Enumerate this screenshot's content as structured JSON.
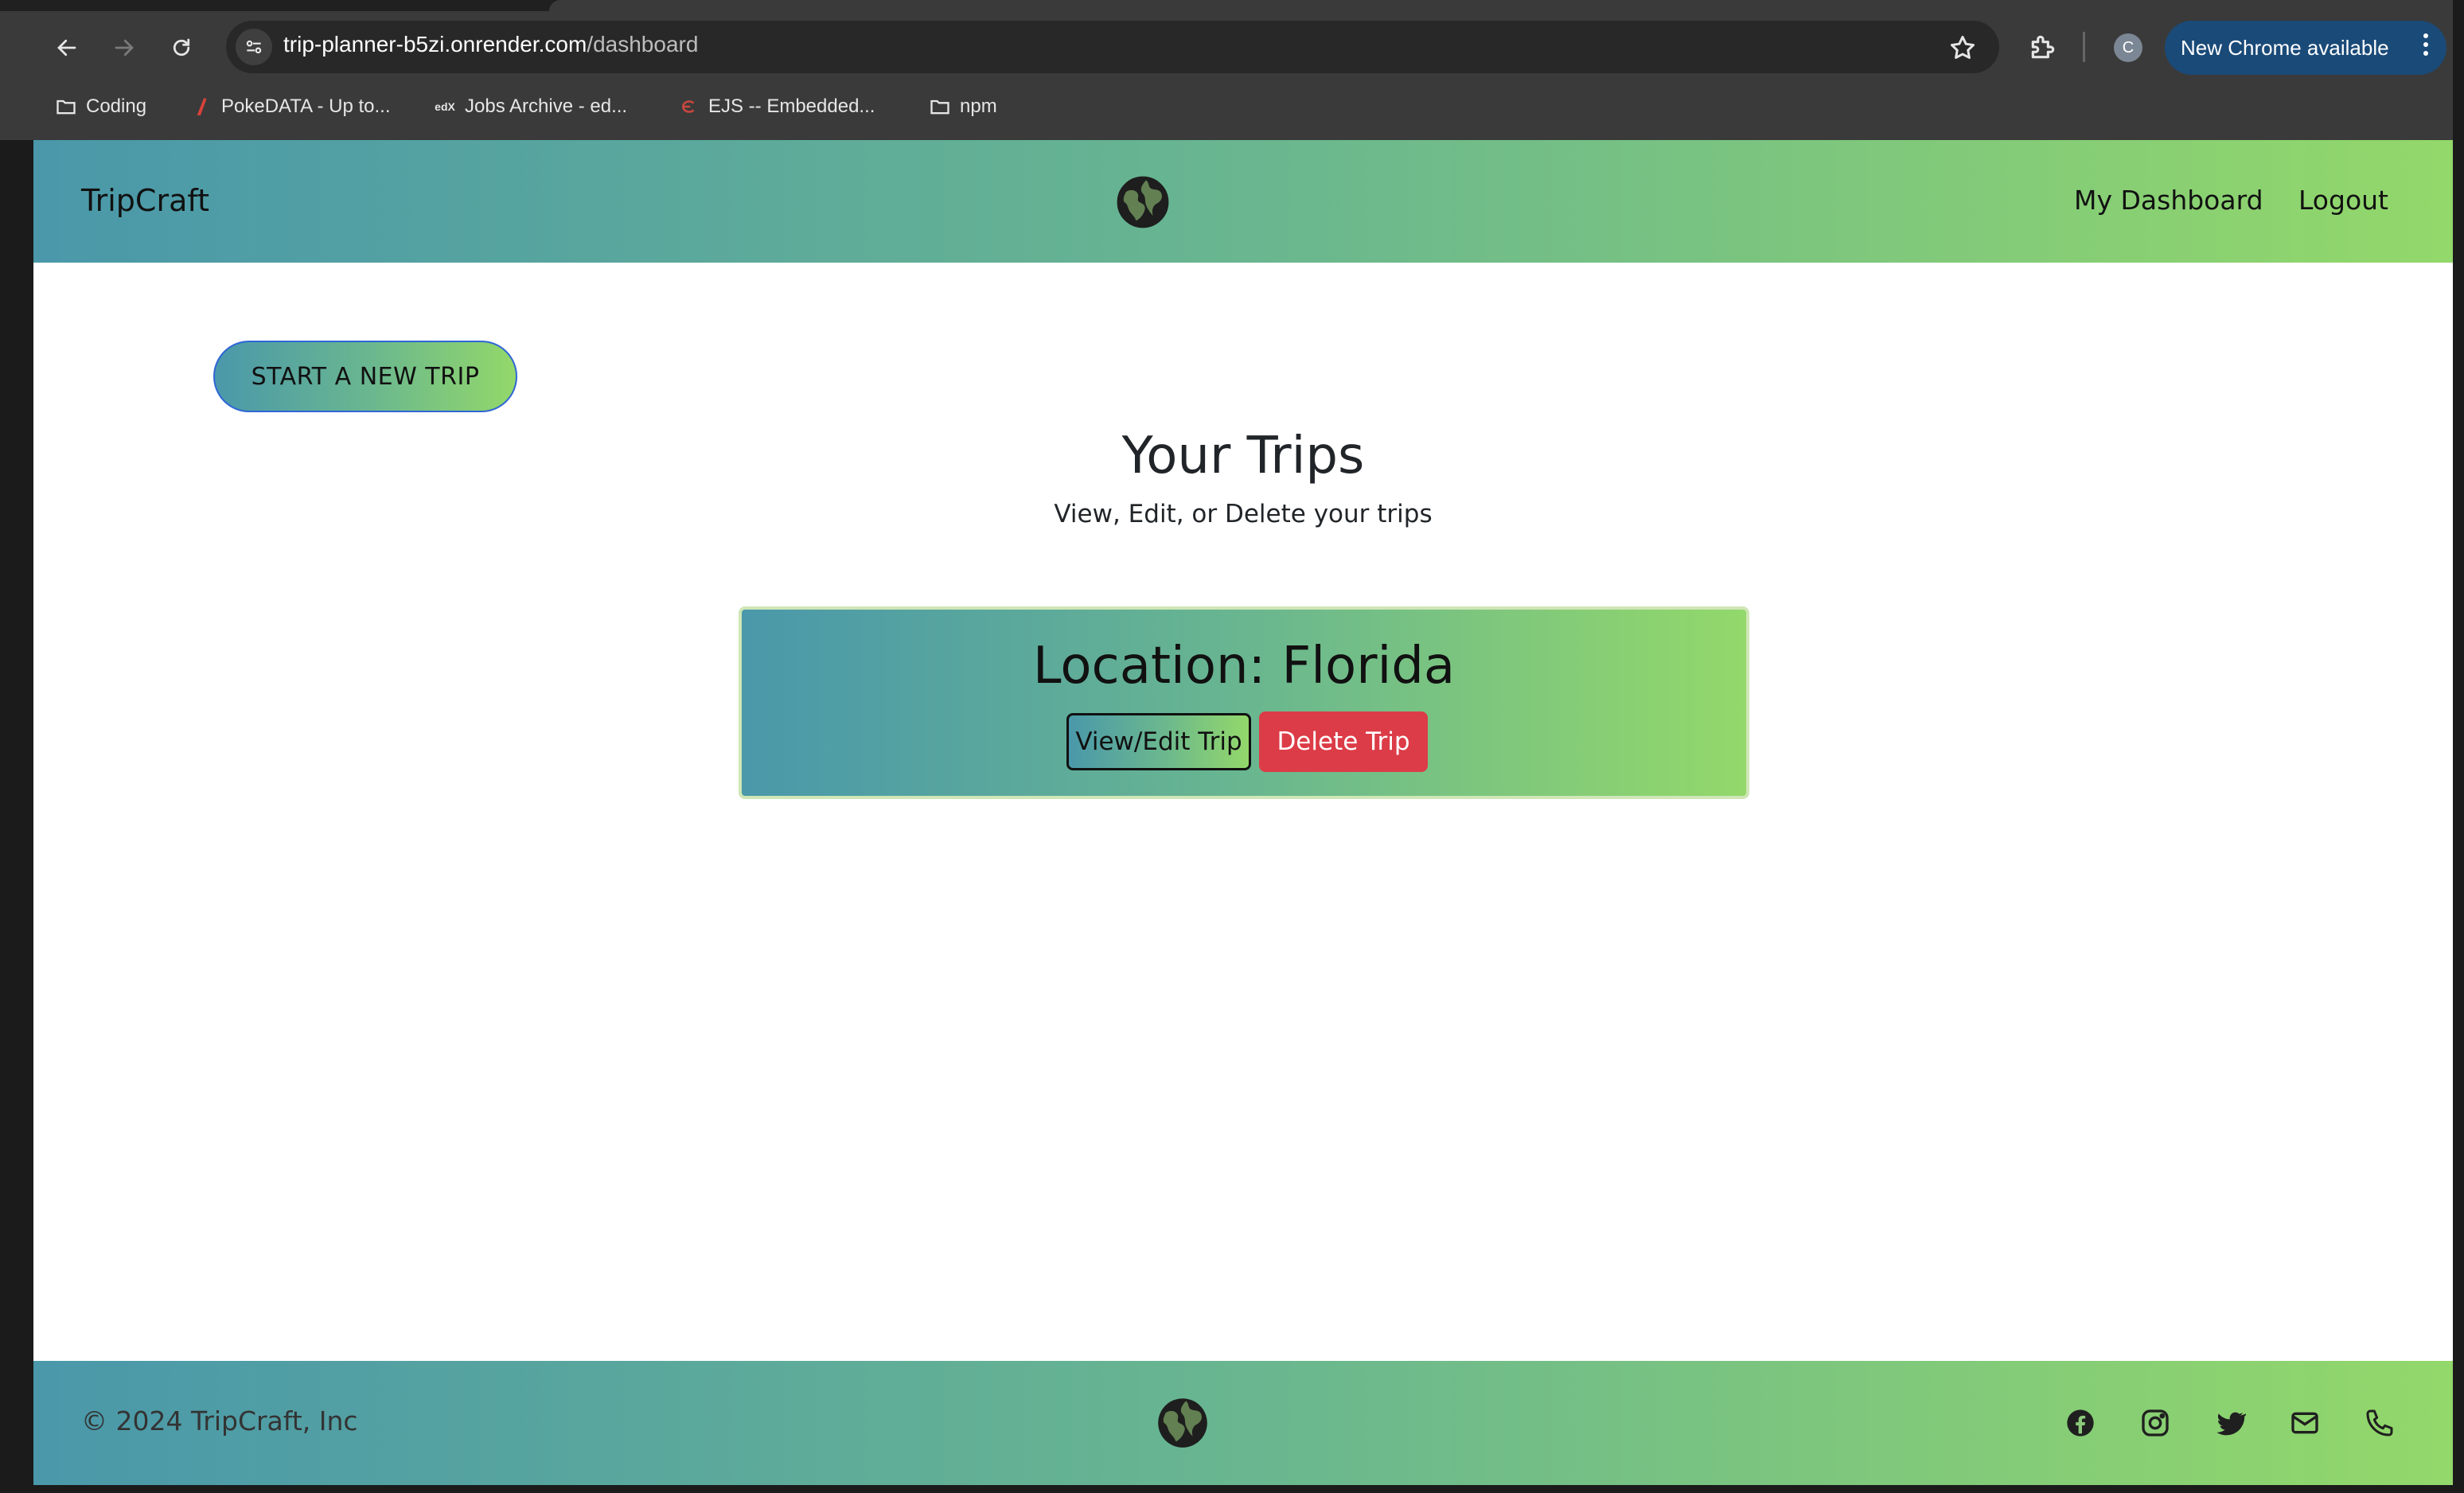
{
  "browser": {
    "url_host": "trip-planner-b5zi.onrender.com",
    "url_path": "/dashboard",
    "profile_initial": "C",
    "update_label": "New Chrome available",
    "bookmarks": [
      {
        "label": "Coding",
        "icon": "folder-icon"
      },
      {
        "label": "PokeDATA - Up to...",
        "icon": "pokedata-icon"
      },
      {
        "label": "Jobs Archive - ed...",
        "icon": "edx-icon"
      },
      {
        "label": "EJS -- Embedded...",
        "icon": "ejs-icon"
      },
      {
        "label": "npm",
        "icon": "folder-icon"
      }
    ]
  },
  "header": {
    "brand": "TripCraft",
    "nav": [
      "My Dashboard",
      "Logout"
    ],
    "logo_icon": "globe-icon"
  },
  "main": {
    "start_button": "START A NEW TRIP",
    "title": "Your Trips",
    "subtitle": "View, Edit, or Delete your trips",
    "trips": [
      {
        "location": "Location: Florida",
        "view_label": "View/Edit Trip",
        "delete_label": "Delete Trip"
      }
    ]
  },
  "footer": {
    "copyright": "© 2024 TripCraft, Inc",
    "social_icons": [
      "facebook-icon",
      "instagram-icon",
      "twitter-icon",
      "email-icon",
      "phone-icon"
    ]
  },
  "colors": {
    "gradient_start": "#4a98aa",
    "gradient_end": "#93d86a",
    "delete": "#dc3c47",
    "update_pill": "#1a4a78"
  }
}
